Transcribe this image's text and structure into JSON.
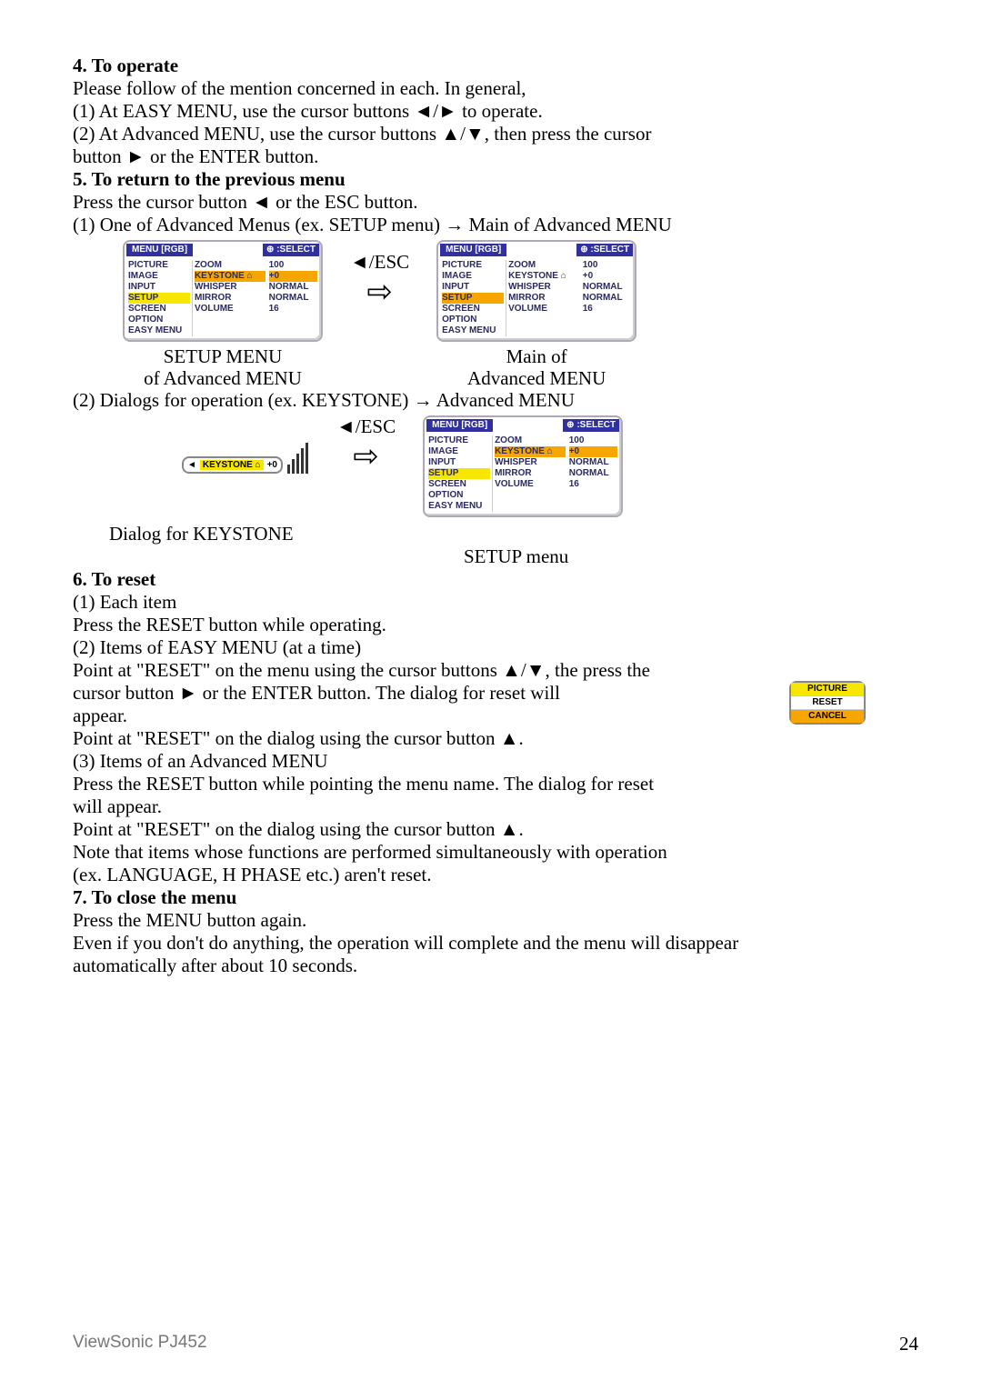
{
  "section4": {
    "heading": "4. To operate",
    "line1": "Please follow of the mention concerned in each. In general,",
    "line2": "(1) At EASY MENU, use the cursor buttons ◄/► to operate.",
    "line3": "(2) At Advanced MENU, use the cursor buttons ▲/▼, then press the cursor",
    "line3b": "button ► or the ENTER button."
  },
  "section5": {
    "heading": "5. To return to the previous menu",
    "line1": "Press the cursor button ◄ or the ESC button.",
    "line2": "(1) One of Advanced Menus (ex. SETUP menu)  →  Main of Advanced MENU",
    "caption_left": "SETUP MENU",
    "caption_left2": "of Advanced MENU",
    "caption_right": "Main of",
    "caption_right2": "Advanced MENU",
    "esc_label": "◄/ESC",
    "line3": "(2) Dialogs for operation (ex. KEYSTONE)  →  Advanced MENU",
    "caption2_left": "Dialog for KEYSTONE",
    "caption2_right": "SETUP menu"
  },
  "menu": {
    "title": "MENU [RGB]",
    "select_hint": ":SELECT",
    "col1": [
      "PICTURE",
      "IMAGE",
      "INPUT",
      "SETUP",
      "SCREEN",
      "OPTION",
      "EASY MENU"
    ],
    "col2": [
      "ZOOM",
      "KEYSTONE ⌂",
      "WHISPER",
      "MIRROR",
      "VOLUME"
    ],
    "col3": [
      "100",
      "+0",
      "NORMAL",
      "NORMAL",
      "16"
    ]
  },
  "keystone": {
    "label": "KEYSTONE ⌂",
    "value": "+0"
  },
  "section6": {
    "heading": "6. To reset",
    "sub1": "(1) Each item",
    "sub1_line": "Press the RESET button while operating.",
    "sub2": "(2) Items of EASY MENU (at a time)",
    "sub2_line1": "Point at \"RESET\" on the menu using the cursor buttons ▲/▼, the press the",
    "sub2_line2": "cursor button ► or the ENTER button. The dialog for reset will",
    "sub2_line3": "appear.",
    "sub2_line4": "Point at \"RESET\" on the dialog using the cursor button ▲.",
    "sub3": "(3) Items of an Advanced MENU",
    "sub3_line1": "Press the RESET button while pointing the menu name. The dialog for reset",
    "sub3_line2": "will appear.",
    "sub3_line3": "Point at \"RESET\" on the dialog using the cursor button ▲.",
    "note1": "Note that items whose functions are performed simultaneously with operation",
    "note2": "(ex. LANGUAGE, H PHASE etc.) aren't reset."
  },
  "reset_dialog": {
    "row1": "PICTURE",
    "row2": "RESET",
    "row3": "CANCEL"
  },
  "section7": {
    "heading": "7. To close the menu",
    "line1": "Press the MENU button again.",
    "line2": "Even if you don't do anything, the operation will complete and the menu will disappear",
    "line3": "automatically after about 10 seconds."
  },
  "footer": {
    "model": "ViewSonic PJ452",
    "page": "24"
  }
}
